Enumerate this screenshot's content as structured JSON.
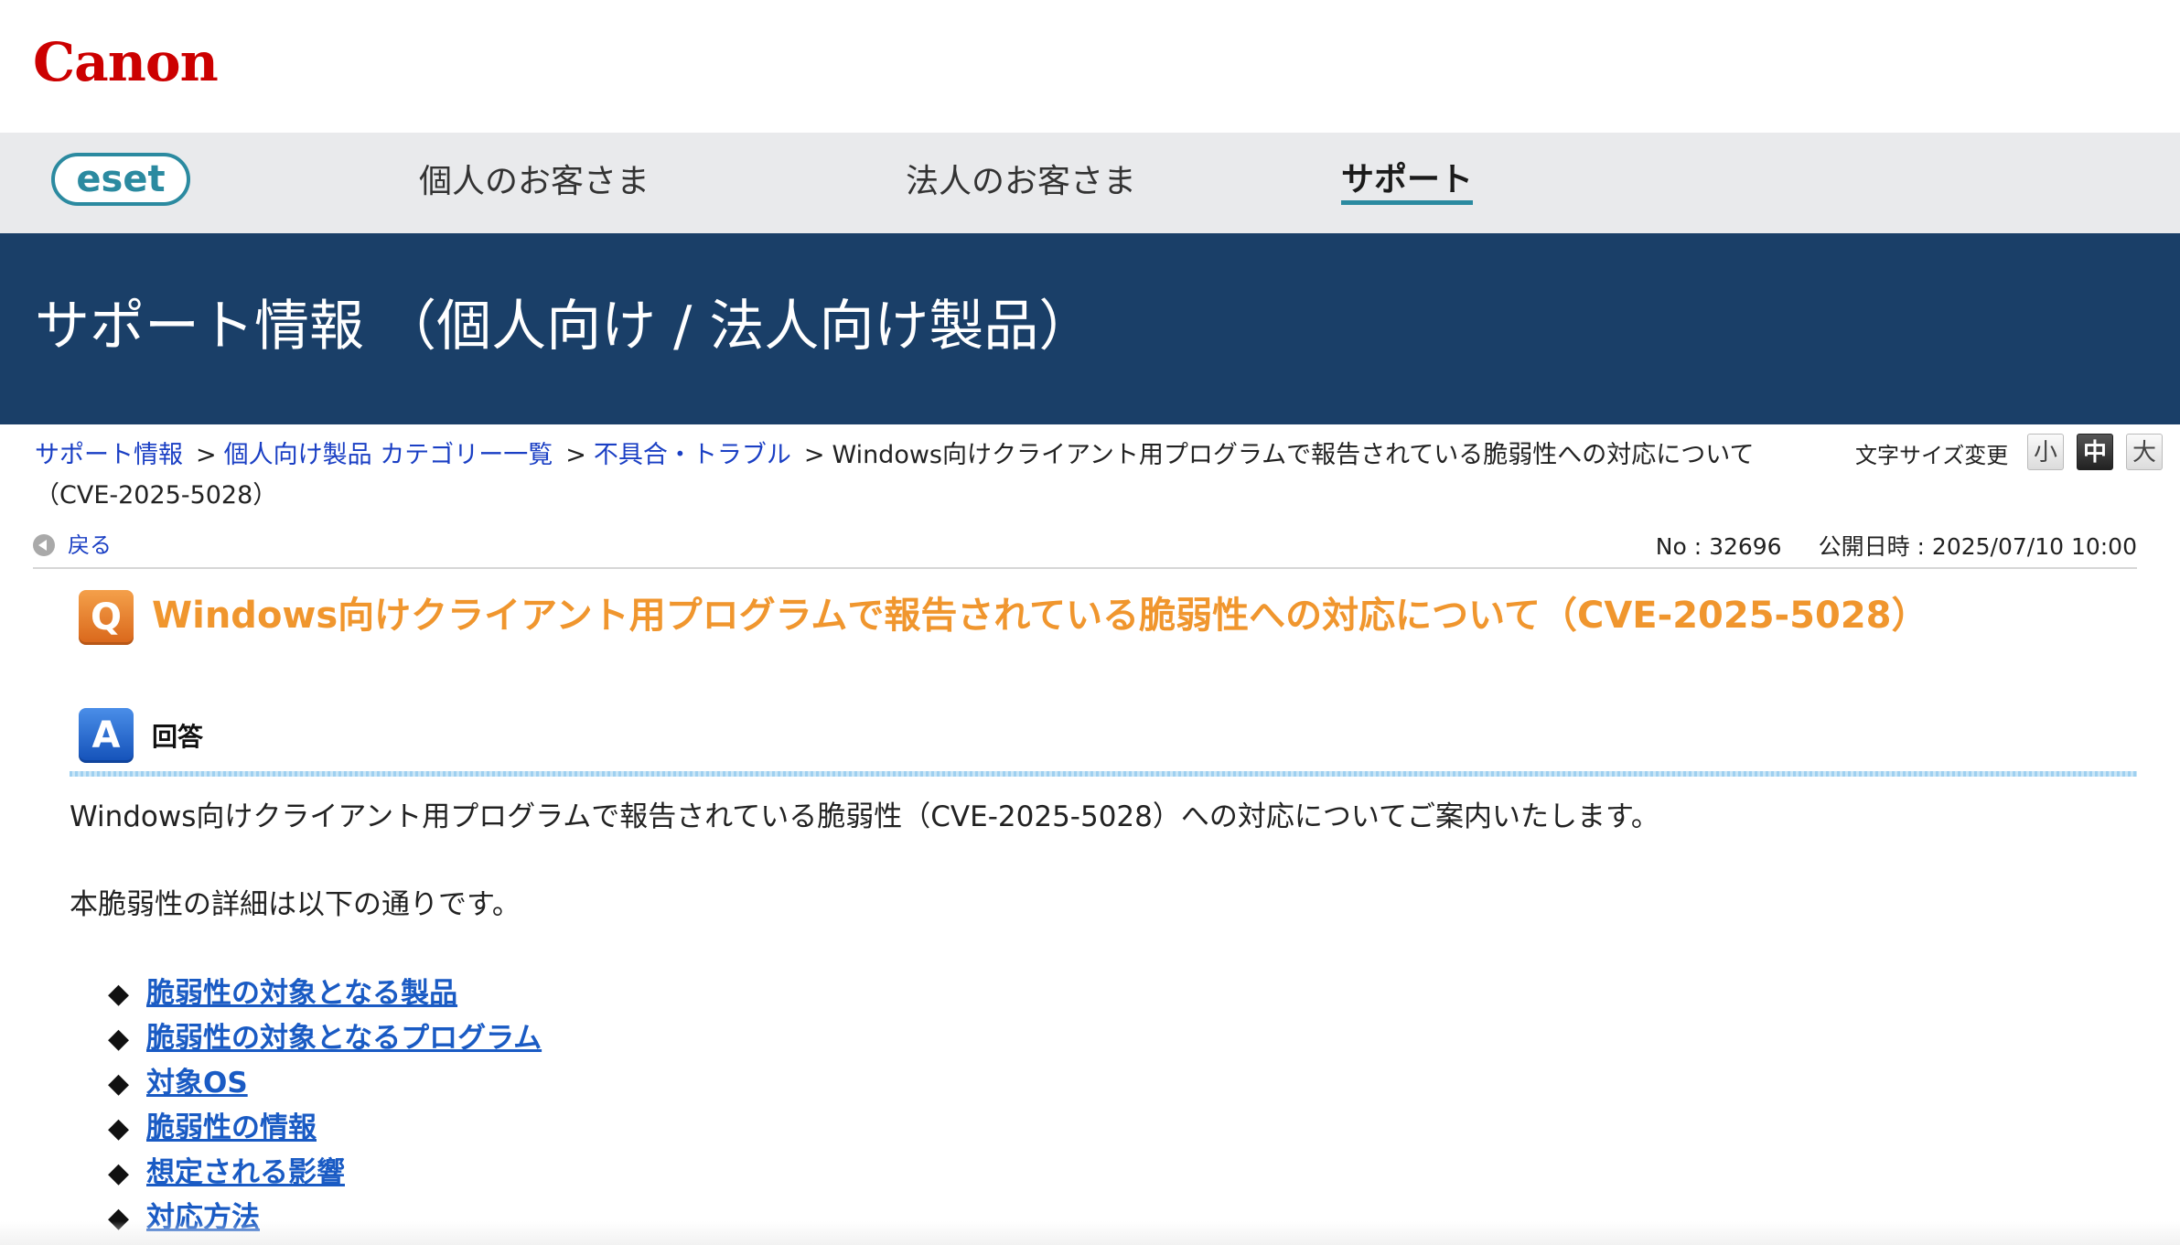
{
  "canon": {
    "logo_text": "Canon"
  },
  "nav": {
    "logo_text": "eset",
    "items": [
      {
        "label": "個人のお客さま"
      },
      {
        "label": "法人のお客さま"
      },
      {
        "label": "サポート",
        "active": true
      }
    ]
  },
  "banner": {
    "title": "サポート情報 （個人向け / 法人向け製品）"
  },
  "breadcrumb": {
    "separator": ">",
    "items": [
      "サポート情報",
      "個人向け製品 カテゴリー一覧",
      "不具合・トラブル"
    ],
    "current": "Windows向けクライアント用プログラムで報告されている脆弱性への対応について（CVE-2025-5028）"
  },
  "font_size": {
    "label": "文字サイズ変更",
    "small": "小",
    "medium": "中",
    "large": "大"
  },
  "back": {
    "label": "戻る"
  },
  "meta": {
    "number": "No : 32696",
    "published": "公開日時 : 2025/07/10 10:00"
  },
  "question": {
    "icon_letter": "Q",
    "title": "Windows向けクライアント用プログラムで報告されている脆弱性への対応について（CVE-2025-5028）"
  },
  "answer": {
    "icon_letter": "A",
    "label": "回答",
    "para1": "Windows向けクライアント用プログラムで報告されている脆弱性（CVE-2025-5028）への対応についてご案内いたします。",
    "para2": "本脆弱性の詳細は以下の通りです。",
    "bullet": "◆",
    "links": [
      "脆弱性の対象となる製品",
      "脆弱性の対象となるプログラム",
      "対象OS",
      "脆弱性の情報",
      "想定される影響",
      "対応方法"
    ]
  },
  "colors": {
    "banner_bg": "#1a3f68",
    "nav_bg": "#e9eaec",
    "canon_red": "#cc0000",
    "question_orange": "#f0962e",
    "link_blue": "#1a3fc4",
    "eset_teal": "#2b8aa0"
  }
}
